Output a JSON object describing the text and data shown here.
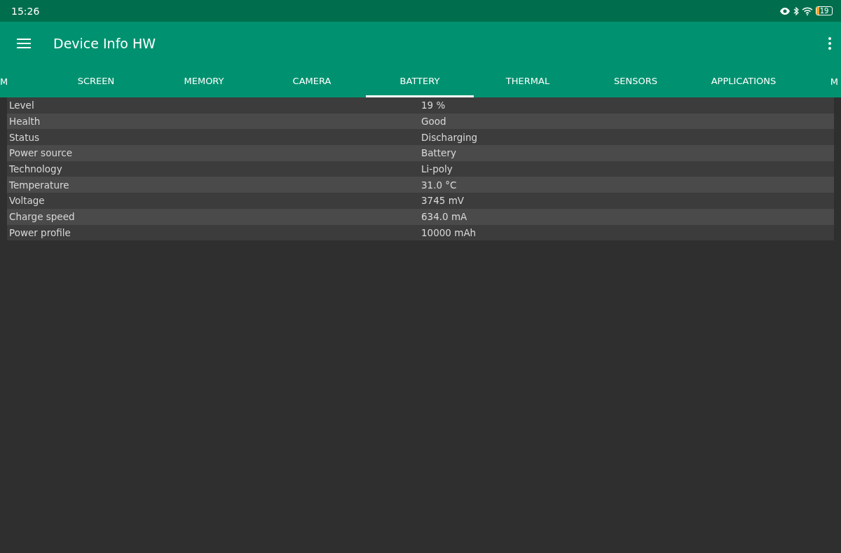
{
  "status_bar": {
    "time": "15:26",
    "battery": {
      "text": "19",
      "level": 0.19
    }
  },
  "app_bar": {
    "title": "Device Info HW"
  },
  "tabs": [
    {
      "label": "M",
      "selected": false
    },
    {
      "label": "SCREEN",
      "selected": false
    },
    {
      "label": "MEMORY",
      "selected": false
    },
    {
      "label": "CAMERA",
      "selected": false
    },
    {
      "label": "BATTERY",
      "selected": true
    },
    {
      "label": "THERMAL",
      "selected": false
    },
    {
      "label": "SENSORS",
      "selected": false
    },
    {
      "label": "APPLICATIONS",
      "selected": false
    },
    {
      "label": "M",
      "selected": false
    }
  ],
  "rows": [
    {
      "label": "Level",
      "value": "19 %"
    },
    {
      "label": "Health",
      "value": "Good"
    },
    {
      "label": "Status",
      "value": "Discharging"
    },
    {
      "label": "Power source",
      "value": "Battery"
    },
    {
      "label": "Technology",
      "value": "Li-poly"
    },
    {
      "label": "Temperature",
      "value": "31.0 °C"
    },
    {
      "label": "Voltage",
      "value": "3745 mV"
    },
    {
      "label": "Charge speed",
      "value": "634.0 mA"
    },
    {
      "label": "Power profile",
      "value": "10000 mAh"
    }
  ]
}
